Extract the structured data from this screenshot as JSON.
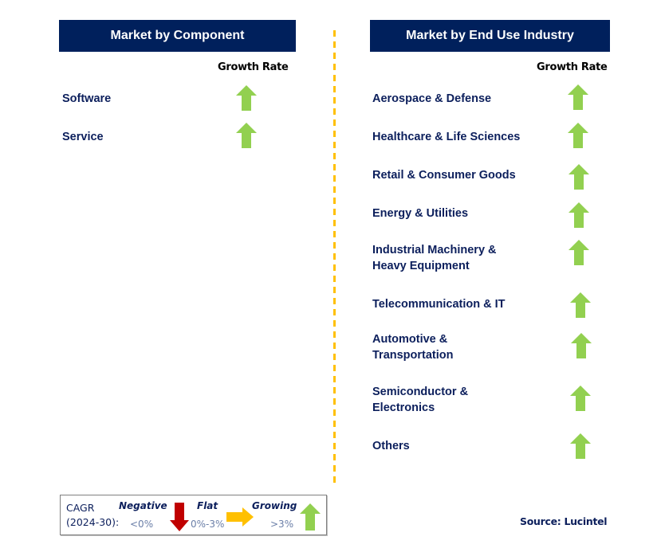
{
  "colors": {
    "header_bg": "#00205c",
    "label_text": "#0c1f5c",
    "growing": "#92d050",
    "negative": "#c00000",
    "flat": "#ffc000",
    "divider": "#ffc000"
  },
  "left_panel": {
    "title": "Market by Component",
    "growth_header": "Growth Rate",
    "items": [
      {
        "label": "Software",
        "trend": "growing",
        "icon": "arrow-up-icon"
      },
      {
        "label": "Service",
        "trend": "growing",
        "icon": "arrow-up-icon"
      }
    ]
  },
  "right_panel": {
    "title": "Market by End Use Industry",
    "growth_header": "Growth Rate",
    "items": [
      {
        "label": "Aerospace & Defense",
        "trend": "growing",
        "icon": "arrow-up-icon"
      },
      {
        "label": "Healthcare & Life Sciences",
        "trend": "growing",
        "icon": "arrow-up-icon"
      },
      {
        "label": "Retail & Consumer Goods",
        "trend": "growing",
        "icon": "arrow-up-icon"
      },
      {
        "label": "Energy & Utilities",
        "trend": "growing",
        "icon": "arrow-up-icon"
      },
      {
        "label": "Industrial Machinery &\nHeavy Equipment",
        "trend": "growing",
        "icon": "arrow-up-icon"
      },
      {
        "label": "Telecommunication & IT",
        "trend": "growing",
        "icon": "arrow-up-icon"
      },
      {
        "label": "Automotive &\nTransportation",
        "trend": "growing",
        "icon": "arrow-up-icon"
      },
      {
        "label": "Semiconductor &\nElectronics",
        "trend": "growing",
        "icon": "arrow-up-icon"
      },
      {
        "label": "Others",
        "trend": "growing",
        "icon": "arrow-up-icon"
      }
    ]
  },
  "legend": {
    "cagr_label": "CAGR\n(2024-30):",
    "categories": [
      {
        "name": "Negative",
        "range": "<0%",
        "icon": "arrow-down-icon"
      },
      {
        "name": "Flat",
        "range": "0%-3%",
        "icon": "arrow-right-icon"
      },
      {
        "name": "Growing",
        "range": ">3%",
        "icon": "arrow-up-icon"
      }
    ]
  },
  "source": "Source: Lucintel"
}
